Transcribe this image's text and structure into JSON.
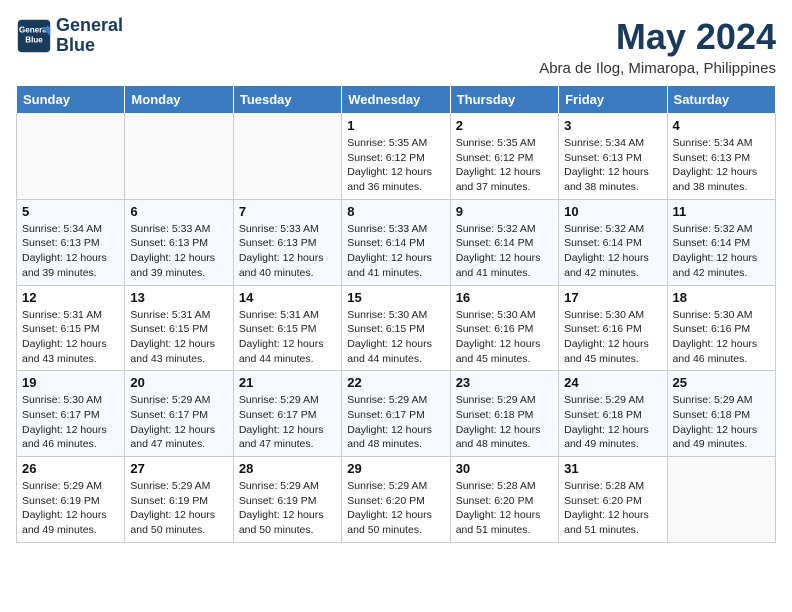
{
  "header": {
    "logo_line1": "General",
    "logo_line2": "Blue",
    "month_year": "May 2024",
    "location": "Abra de Ilog, Mimaropa, Philippines"
  },
  "weekdays": [
    "Sunday",
    "Monday",
    "Tuesday",
    "Wednesday",
    "Thursday",
    "Friday",
    "Saturday"
  ],
  "weeks": [
    [
      {
        "day": "",
        "sunrise": "",
        "sunset": "",
        "daylight": ""
      },
      {
        "day": "",
        "sunrise": "",
        "sunset": "",
        "daylight": ""
      },
      {
        "day": "",
        "sunrise": "",
        "sunset": "",
        "daylight": ""
      },
      {
        "day": "1",
        "sunrise": "Sunrise: 5:35 AM",
        "sunset": "Sunset: 6:12 PM",
        "daylight": "Daylight: 12 hours and 36 minutes."
      },
      {
        "day": "2",
        "sunrise": "Sunrise: 5:35 AM",
        "sunset": "Sunset: 6:12 PM",
        "daylight": "Daylight: 12 hours and 37 minutes."
      },
      {
        "day": "3",
        "sunrise": "Sunrise: 5:34 AM",
        "sunset": "Sunset: 6:13 PM",
        "daylight": "Daylight: 12 hours and 38 minutes."
      },
      {
        "day": "4",
        "sunrise": "Sunrise: 5:34 AM",
        "sunset": "Sunset: 6:13 PM",
        "daylight": "Daylight: 12 hours and 38 minutes."
      }
    ],
    [
      {
        "day": "5",
        "sunrise": "Sunrise: 5:34 AM",
        "sunset": "Sunset: 6:13 PM",
        "daylight": "Daylight: 12 hours and 39 minutes."
      },
      {
        "day": "6",
        "sunrise": "Sunrise: 5:33 AM",
        "sunset": "Sunset: 6:13 PM",
        "daylight": "Daylight: 12 hours and 39 minutes."
      },
      {
        "day": "7",
        "sunrise": "Sunrise: 5:33 AM",
        "sunset": "Sunset: 6:13 PM",
        "daylight": "Daylight: 12 hours and 40 minutes."
      },
      {
        "day": "8",
        "sunrise": "Sunrise: 5:33 AM",
        "sunset": "Sunset: 6:14 PM",
        "daylight": "Daylight: 12 hours and 41 minutes."
      },
      {
        "day": "9",
        "sunrise": "Sunrise: 5:32 AM",
        "sunset": "Sunset: 6:14 PM",
        "daylight": "Daylight: 12 hours and 41 minutes."
      },
      {
        "day": "10",
        "sunrise": "Sunrise: 5:32 AM",
        "sunset": "Sunset: 6:14 PM",
        "daylight": "Daylight: 12 hours and 42 minutes."
      },
      {
        "day": "11",
        "sunrise": "Sunrise: 5:32 AM",
        "sunset": "Sunset: 6:14 PM",
        "daylight": "Daylight: 12 hours and 42 minutes."
      }
    ],
    [
      {
        "day": "12",
        "sunrise": "Sunrise: 5:31 AM",
        "sunset": "Sunset: 6:15 PM",
        "daylight": "Daylight: 12 hours and 43 minutes."
      },
      {
        "day": "13",
        "sunrise": "Sunrise: 5:31 AM",
        "sunset": "Sunset: 6:15 PM",
        "daylight": "Daylight: 12 hours and 43 minutes."
      },
      {
        "day": "14",
        "sunrise": "Sunrise: 5:31 AM",
        "sunset": "Sunset: 6:15 PM",
        "daylight": "Daylight: 12 hours and 44 minutes."
      },
      {
        "day": "15",
        "sunrise": "Sunrise: 5:30 AM",
        "sunset": "Sunset: 6:15 PM",
        "daylight": "Daylight: 12 hours and 44 minutes."
      },
      {
        "day": "16",
        "sunrise": "Sunrise: 5:30 AM",
        "sunset": "Sunset: 6:16 PM",
        "daylight": "Daylight: 12 hours and 45 minutes."
      },
      {
        "day": "17",
        "sunrise": "Sunrise: 5:30 AM",
        "sunset": "Sunset: 6:16 PM",
        "daylight": "Daylight: 12 hours and 45 minutes."
      },
      {
        "day": "18",
        "sunrise": "Sunrise: 5:30 AM",
        "sunset": "Sunset: 6:16 PM",
        "daylight": "Daylight: 12 hours and 46 minutes."
      }
    ],
    [
      {
        "day": "19",
        "sunrise": "Sunrise: 5:30 AM",
        "sunset": "Sunset: 6:17 PM",
        "daylight": "Daylight: 12 hours and 46 minutes."
      },
      {
        "day": "20",
        "sunrise": "Sunrise: 5:29 AM",
        "sunset": "Sunset: 6:17 PM",
        "daylight": "Daylight: 12 hours and 47 minutes."
      },
      {
        "day": "21",
        "sunrise": "Sunrise: 5:29 AM",
        "sunset": "Sunset: 6:17 PM",
        "daylight": "Daylight: 12 hours and 47 minutes."
      },
      {
        "day": "22",
        "sunrise": "Sunrise: 5:29 AM",
        "sunset": "Sunset: 6:17 PM",
        "daylight": "Daylight: 12 hours and 48 minutes."
      },
      {
        "day": "23",
        "sunrise": "Sunrise: 5:29 AM",
        "sunset": "Sunset: 6:18 PM",
        "daylight": "Daylight: 12 hours and 48 minutes."
      },
      {
        "day": "24",
        "sunrise": "Sunrise: 5:29 AM",
        "sunset": "Sunset: 6:18 PM",
        "daylight": "Daylight: 12 hours and 49 minutes."
      },
      {
        "day": "25",
        "sunrise": "Sunrise: 5:29 AM",
        "sunset": "Sunset: 6:18 PM",
        "daylight": "Daylight: 12 hours and 49 minutes."
      }
    ],
    [
      {
        "day": "26",
        "sunrise": "Sunrise: 5:29 AM",
        "sunset": "Sunset: 6:19 PM",
        "daylight": "Daylight: 12 hours and 49 minutes."
      },
      {
        "day": "27",
        "sunrise": "Sunrise: 5:29 AM",
        "sunset": "Sunset: 6:19 PM",
        "daylight": "Daylight: 12 hours and 50 minutes."
      },
      {
        "day": "28",
        "sunrise": "Sunrise: 5:29 AM",
        "sunset": "Sunset: 6:19 PM",
        "daylight": "Daylight: 12 hours and 50 minutes."
      },
      {
        "day": "29",
        "sunrise": "Sunrise: 5:29 AM",
        "sunset": "Sunset: 6:20 PM",
        "daylight": "Daylight: 12 hours and 50 minutes."
      },
      {
        "day": "30",
        "sunrise": "Sunrise: 5:28 AM",
        "sunset": "Sunset: 6:20 PM",
        "daylight": "Daylight: 12 hours and 51 minutes."
      },
      {
        "day": "31",
        "sunrise": "Sunrise: 5:28 AM",
        "sunset": "Sunset: 6:20 PM",
        "daylight": "Daylight: 12 hours and 51 minutes."
      },
      {
        "day": "",
        "sunrise": "",
        "sunset": "",
        "daylight": ""
      }
    ]
  ]
}
